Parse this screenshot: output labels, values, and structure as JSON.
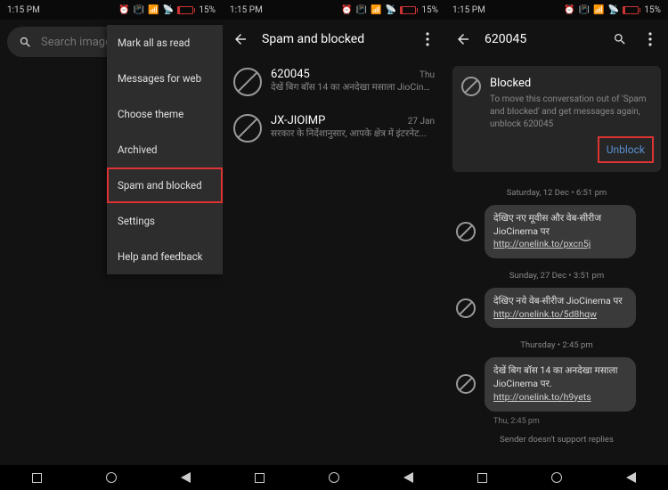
{
  "statusbar": {
    "time": "1:15 PM",
    "battery_pct": "15%"
  },
  "panel1": {
    "search_placeholder": "Search images",
    "menu": {
      "mark_all": "Mark all as read",
      "web": "Messages for web",
      "theme": "Choose theme",
      "archived": "Archived",
      "spam": "Spam and blocked",
      "settings": "Settings",
      "help": "Help and feedback"
    }
  },
  "panel2": {
    "title": "Spam and blocked",
    "items": [
      {
        "title": "620045",
        "time": "Thu",
        "sub": "देखें बिग बॉस 14 का अनदेखा मसाला JioCine..."
      },
      {
        "title": "JX-JIOIMP",
        "time": "27 Jan",
        "sub": "सरकार के निर्देशानुसार, आपके क्षेत्र में इंटरनेट..."
      }
    ]
  },
  "panel3": {
    "title": "620045",
    "blocked": {
      "heading": "Blocked",
      "desc": "To move this conversation out of 'Spam and blocked' and get messages again, unblock 620045",
      "unblock_label": "Unblock"
    },
    "messages": [
      {
        "date": "Saturday, 12 Dec • 6:51 pm",
        "text": "देखिए नए मूवीस और वेब-सीरीज JioCinema पर ",
        "link": "http://onelink.to/pxcn5j",
        "time": ""
      },
      {
        "date": "Sunday, 27 Dec • 3:51 pm",
        "text": "देखिए नये वेब-सीरीज JioCinema पर ",
        "link": "http://onelink.to/5d8hqw",
        "time": ""
      },
      {
        "date": "Thursday • 2:45 pm",
        "text": "देखें बिग बॉस 14 का अनदेखा मसाला JioCinema पर. ",
        "link": "http://onelink.to/h9yets",
        "time": "Thu, 2:45 pm"
      }
    ],
    "footer": "Sender doesn't support replies"
  }
}
